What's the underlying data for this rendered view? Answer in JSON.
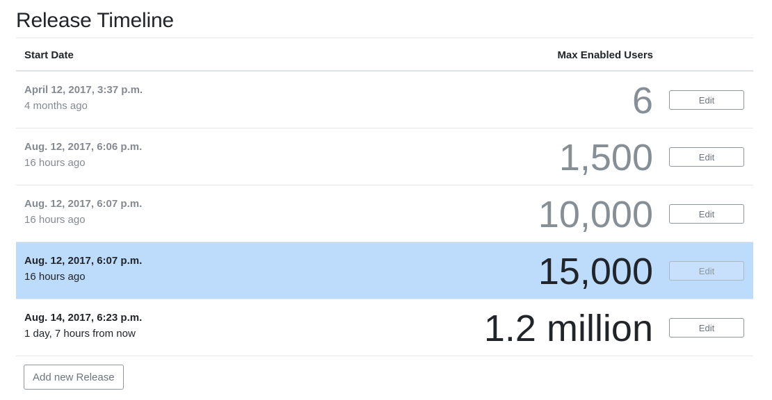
{
  "page": {
    "title": "Release Timeline"
  },
  "table": {
    "headers": {
      "start_date": "Start Date",
      "max_users": "Max Enabled Users"
    },
    "rows": [
      {
        "date": "April 12, 2017, 3:37 p.m.",
        "relative": "4 months ago",
        "value": "6",
        "state": "past",
        "edit_label": "Edit"
      },
      {
        "date": "Aug. 12, 2017, 6:06 p.m.",
        "relative": "16 hours ago",
        "value": "1,500",
        "state": "past",
        "edit_label": "Edit"
      },
      {
        "date": "Aug. 12, 2017, 6:07 p.m.",
        "relative": "16 hours ago",
        "value": "10,000",
        "state": "past",
        "edit_label": "Edit"
      },
      {
        "date": "Aug. 12, 2017, 6:07 p.m.",
        "relative": "16 hours ago",
        "value": "15,000",
        "state": "current",
        "edit_label": "Edit"
      },
      {
        "date": "Aug. 14, 2017, 6:23 p.m.",
        "relative": "1 day, 7 hours from now",
        "value": "1.2 million",
        "state": "future",
        "edit_label": "Edit"
      }
    ]
  },
  "actions": {
    "add_label": "Add new Release"
  },
  "colors": {
    "active_row": "#bddbfb",
    "past_text": "#868e96",
    "text": "#212529"
  }
}
